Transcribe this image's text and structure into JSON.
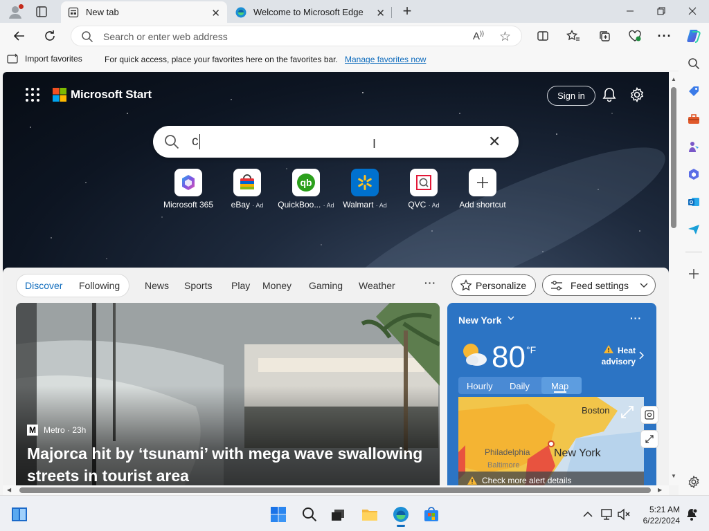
{
  "tabs": [
    {
      "title": "New tab",
      "active": true
    },
    {
      "title": "Welcome to Microsoft Edge",
      "active": false
    }
  ],
  "address_bar": {
    "placeholder": "Search or enter web address",
    "value": ""
  },
  "favorites_bar": {
    "import_label": "Import favorites",
    "message": "For quick access, place your favorites here on the favorites bar.",
    "manage_link": "Manage favorites now"
  },
  "page": {
    "brand": "Microsoft Start",
    "sign_in": "Sign in",
    "search": {
      "value": "c"
    },
    "shortcuts": [
      {
        "label": "Microsoft 365",
        "ad": "",
        "icon": "microsoft-365-icon"
      },
      {
        "label": "eBay",
        "ad": "· Ad",
        "icon": "ebay-icon"
      },
      {
        "label": "QuickBoo...",
        "ad": "· Ad",
        "icon": "quickbooks-icon"
      },
      {
        "label": "Walmart",
        "ad": "· Ad",
        "icon": "walmart-icon"
      },
      {
        "label": "QVC",
        "ad": "· Ad",
        "icon": "qvc-icon"
      },
      {
        "label": "Add shortcut",
        "ad": "",
        "icon": "plus-icon"
      }
    ]
  },
  "feed": {
    "nav": [
      "Discover",
      "Following",
      "News",
      "Sports",
      "Play",
      "Money",
      "Gaming",
      "Weather"
    ],
    "more": "···",
    "personalize": "Personalize",
    "feed_settings": "Feed settings",
    "hero": {
      "source": "Metro · 23h",
      "title": "Majorca hit by ‘tsunami’ with mega wave swallowing streets in tourist area"
    },
    "weather": {
      "city": "New York",
      "temperature": "80",
      "unit": "°F",
      "alert_line1": "Heat",
      "alert_line2": "advisory",
      "tabs": [
        "Hourly",
        "Daily",
        "Map"
      ],
      "active_tab": "Map",
      "map_labels": {
        "boston": "Boston",
        "philadelphia": "Philadelphia",
        "new_york": "New York",
        "baltimore": "Baltimore"
      },
      "alert_bar": "Check more alert details"
    }
  },
  "taskbar": {
    "time": "5:21 AM",
    "date": "6/22/2024"
  },
  "colors": {
    "accent": "#0f6cbd",
    "weather_bg": "#2c74c4",
    "tab_bar": "#dfe3e8"
  }
}
